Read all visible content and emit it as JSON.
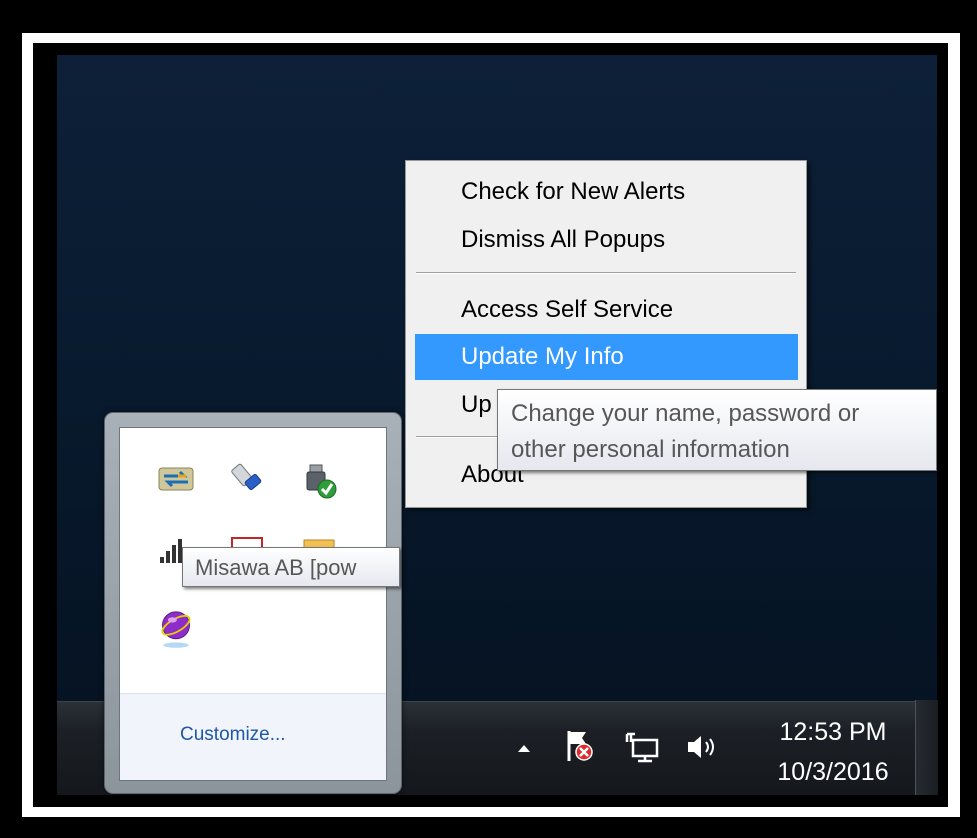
{
  "context_menu": {
    "items": [
      {
        "label": "Check for New Alerts"
      },
      {
        "label": "Dismiss All Popups"
      },
      {
        "label": "Access Self Service"
      },
      {
        "label": "Update My Info",
        "highlighted": true
      },
      {
        "label": "Up"
      },
      {
        "label": "About"
      }
    ]
  },
  "tooltip_update": {
    "line1": "Change your name, password or",
    "line2": "other personal information"
  },
  "tray_overflow": {
    "icons": [
      "exchange-arrows-icon",
      "usb-eject-icon",
      "usb-connected-check-icon",
      "signal-bars-icon",
      "red-envelope-icon",
      "folder-icon",
      "purple-orb-icon"
    ],
    "tooltip": "Misawa AB [pow",
    "customize_label": "Customize..."
  },
  "taskbar": {
    "icons": [
      "show-hidden-icons-arrow-icon",
      "action-center-flag-icon",
      "network-icon",
      "volume-icon"
    ],
    "time": "12:53 PM",
    "date": "10/3/2016"
  },
  "colors": {
    "highlight": "#3399ff",
    "link": "#1e57a8",
    "desktop": "#0d2038"
  }
}
